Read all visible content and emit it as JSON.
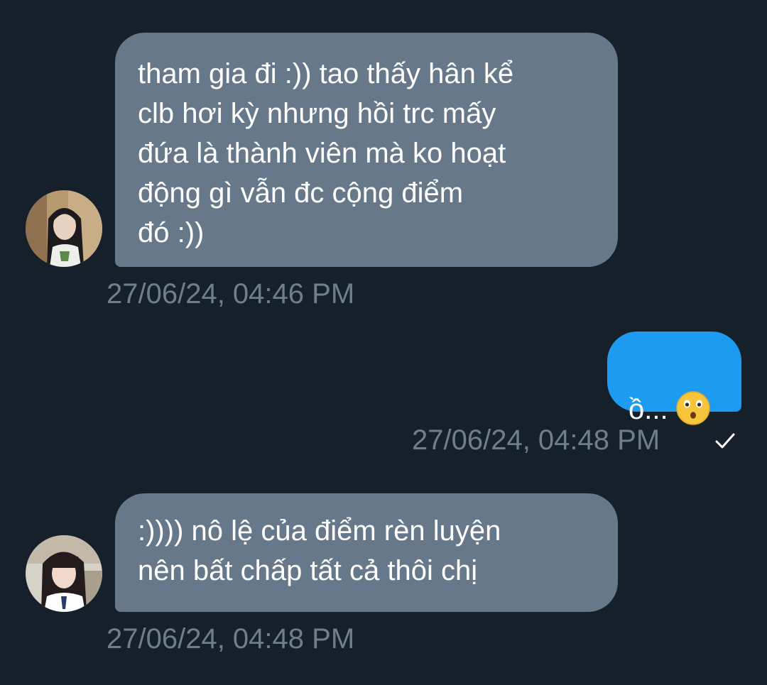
{
  "conversation": {
    "messages": [
      {
        "direction": "received",
        "text": "tham gia đi :)) tao thấy hân kể\nclb hơi kỳ nhưng hồi trc mấy\nđứa là thành viên mà ko hoạt\nđộng gì vẫn đc cộng điểm\nđó :))",
        "timestamp": "27/06/24, 04:46 PM",
        "avatar": "avatar-long-dark-hair"
      },
      {
        "direction": "sent",
        "text": "ồ...",
        "emoji": "hushed-face-emoji",
        "timestamp": "27/06/24, 04:48 PM",
        "status_icon": "checkmark-icon"
      },
      {
        "direction": "received",
        "text": ":)))) nô lệ của điểm rèn luyện\nnên bất chấp tất cả thôi chị",
        "timestamp": "27/06/24, 04:48 PM",
        "avatar": "avatar-bangs-hair"
      }
    ]
  },
  "colors": {
    "background": "#16202b",
    "received_bubble": "#66788a",
    "sent_bubble": "#1d9bf0",
    "timestamp": "#6e7e8d",
    "text": "#ffffff"
  }
}
